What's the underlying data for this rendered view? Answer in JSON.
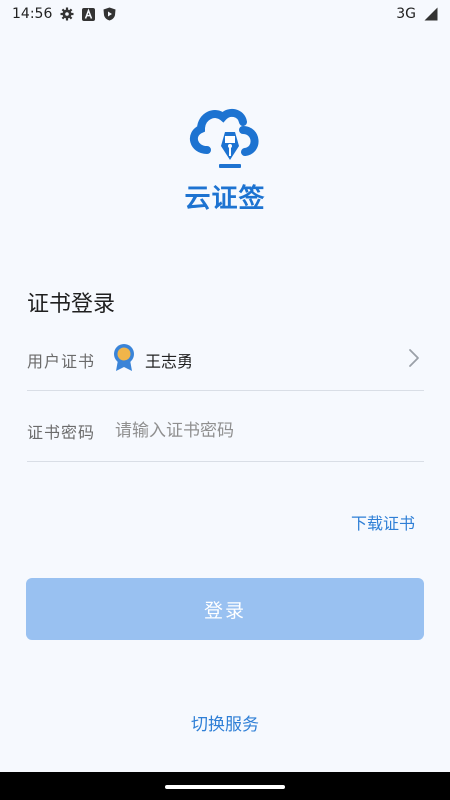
{
  "status_bar": {
    "time": "14:56",
    "network": "3G",
    "left_icons": [
      "gear-icon",
      "font-a-icon",
      "shield-play-icon"
    ],
    "right_icons": [
      "signal-icon"
    ]
  },
  "logo": {
    "text": "云证签",
    "icon": "cloud-pen-logo-icon",
    "color": "#1d73d1"
  },
  "login": {
    "title": "证书登录",
    "cert_label": "用户证书",
    "cert_value": "王志勇",
    "cert_icon": "certificate-badge-icon",
    "password_label": "证书密码",
    "password_placeholder": "请输入证书密码",
    "password_value": "",
    "download_link": "下载证书",
    "submit_label": "登录",
    "switch_service": "切换服务"
  },
  "colors": {
    "accent": "#2f7fd6",
    "button_disabled": "#99c1f1",
    "background": "#f6f9fe"
  }
}
